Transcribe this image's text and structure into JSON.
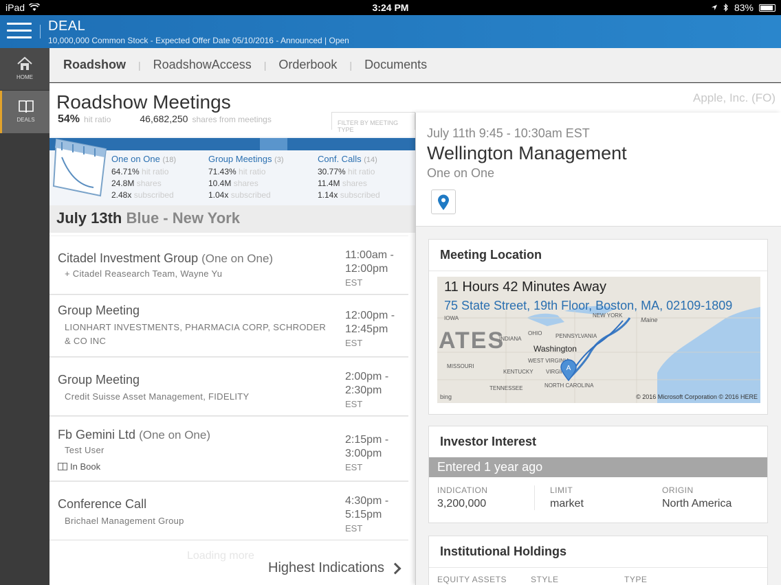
{
  "status": {
    "device": "iPad",
    "time": "3:24 PM",
    "battery": "83%"
  },
  "header": {
    "title": "DEAL",
    "subtitle": "10,000,000 Common Stock - Expected Offer Date 05/10/2016 - Announced | Open"
  },
  "rail": {
    "home_label": "HOME",
    "deals_label": "DEALS"
  },
  "tabs": [
    {
      "label": "Roadshow",
      "active": true
    },
    {
      "label": "RoadshowAccess",
      "active": false
    },
    {
      "label": "Orderbook",
      "active": false
    },
    {
      "label": "Documents",
      "active": false
    }
  ],
  "page": {
    "title": "Roadshow Meetings",
    "company": "Apple, Inc. (FO)",
    "hit_ratio": "54%",
    "hit_ratio_label": "hit ratio",
    "shares": "46,682,250",
    "shares_label": "shares from meetings",
    "filter_label": "FILTER BY MEETING TYPE"
  },
  "stats": [
    {
      "name": "One on One",
      "count": "(18)",
      "ratio": "64.71%",
      "ratio_label": "hit ratio",
      "shares": "24.8M",
      "shares_label": "shares",
      "subscribed": "2.48x",
      "subscribed_label": "subscribed"
    },
    {
      "name": "Group Meetings",
      "count": "(3)",
      "ratio": "71.43%",
      "ratio_label": "hit ratio",
      "shares": "10.4M",
      "shares_label": "shares",
      "subscribed": "1.04x",
      "subscribed_label": "subscribed"
    },
    {
      "name": "Conf. Calls",
      "count": "(14)",
      "ratio": "30.77%",
      "ratio_label": "hit ratio",
      "shares": "11.4M",
      "shares_label": "shares",
      "subscribed": "1.14x",
      "subscribed_label": "subscribed"
    }
  ],
  "day": {
    "date": "July 13th",
    "location": "Blue - New York"
  },
  "meetings": [
    {
      "name": "Citadel Investment Group",
      "type": "(One on One)",
      "sub": "+ Citadel Reasearch Team, Wayne Yu",
      "start": "11:00am -",
      "end": "12:00pm",
      "tz": "EST"
    },
    {
      "name": "Group Meeting",
      "type": "",
      "sub": "LIONHART INVESTMENTS, PHARMACIA CORP, SCHRODER & CO INC",
      "start": "12:00pm -",
      "end": "12:45pm",
      "tz": "EST"
    },
    {
      "name": "Group Meeting",
      "type": "",
      "sub": "Credit Suisse Asset Management, FIDELITY",
      "start": "2:00pm -",
      "end": "2:30pm",
      "tz": "EST"
    },
    {
      "name": "Fb Gemini Ltd",
      "type": "(One on One)",
      "sub": "Test User",
      "book": "In Book",
      "start": "2:15pm -",
      "end": "3:00pm",
      "tz": "EST"
    },
    {
      "name": "Conference Call",
      "type": "",
      "sub": "Brichael Management Group",
      "start": "4:30pm -",
      "end": "5:15pm",
      "tz": "EST"
    }
  ],
  "loading": "Loading more",
  "highest": "Highest Indications",
  "detail": {
    "time": "July 11th 9:45 - 10:30am EST",
    "name": "Wellington Management",
    "type": "One on One",
    "location_title": "Meeting Location",
    "away": "11 Hours 42 Minutes Away",
    "address": "75 State Street, 19th Floor, Boston, MA, 02109-1809",
    "map_labels": {
      "iowa": "IOWA",
      "new_york": "NEW YORK",
      "maine": "Maine",
      "ohio": "OHIO",
      "indiana": "INDIANA",
      "pennsylvania": "PENNSYLVANIA",
      "washington": "Washington",
      "west_virginia": "WEST VIRGINIA",
      "missouri": "MISSOURI",
      "kentucky": "KENTUCKY",
      "virginia": "VIRGINIA",
      "tennessee": "TENNESSEE",
      "north_carolina": "NORTH CAROLINA",
      "states": "ATES",
      "pin": "A"
    },
    "map_copyright": "© 2016 Microsoft Corporation © 2016 HERE",
    "map_brand": "bing",
    "interest_title": "Investor Interest",
    "entered": "Entered 1 year ago",
    "indication_label": "INDICATION",
    "indication": "3,200,000",
    "limit_label": "LIMIT",
    "limit": "market",
    "origin_label": "ORIGIN",
    "origin": "North America",
    "holdings_title": "Institutional Holdings",
    "holdings_cols": [
      "EQUITY ASSETS",
      "STYLE",
      "TYPE"
    ]
  },
  "colors": {
    "brand_blue": "#2a6fb0",
    "header_blue": "#1e6fb5",
    "accent_orange": "#e2a32b"
  }
}
